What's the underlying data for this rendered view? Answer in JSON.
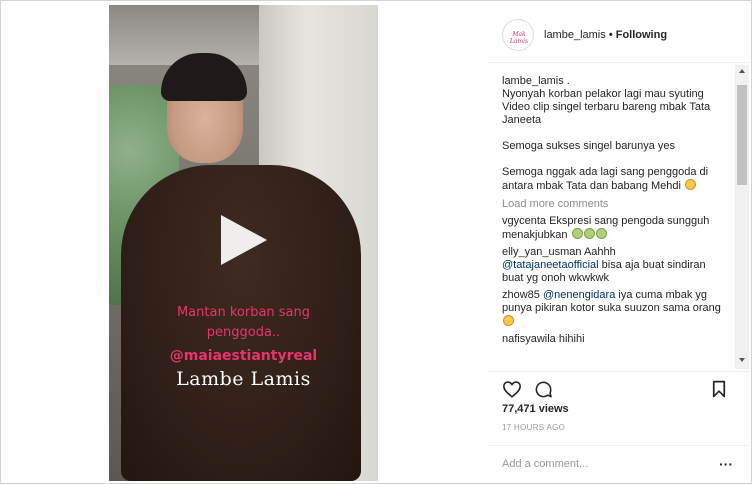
{
  "post": {
    "username": "lambe_lamis",
    "separator": "•",
    "follow_label": "Following",
    "avatar_text": "Mak Lamis"
  },
  "video": {
    "overlay_line1": "Mantan korban sang",
    "overlay_line2": "penggoda..",
    "overlay_mention": "@maiaestiantyreal",
    "overlay_brand": "Lambe Lamis"
  },
  "caption": {
    "username": "lambe_lamis .",
    "lines": [
      "Nyonyah korban pelakor lagi mau syuting",
      "Video clip singel terbaru bareng mbak Tata",
      "Janeeta",
      "",
      "Semoga sukses singel barunya yes",
      "",
      "Semoga nggak ada lagi sang penggoda di",
      "antara mbak Tata dan babang Mehdi"
    ]
  },
  "load_more": "Load more comments",
  "comments": [
    {
      "user": "vgycenta",
      "text": "Ekspresi sang pengoda sungguh menakjubkan"
    },
    {
      "user": "elly_yan_usman",
      "text": "Aahhh",
      "mention": "@tatajaneetaofficial",
      "text2": "bisa aja buat sindiran buat yg onoh wkwkwk"
    },
    {
      "user": "zhow85",
      "mention": "@nenengidara",
      "text": "iya cuma mbak yg punya pikiran kotor suka suuzon sama orang"
    },
    {
      "user": "nafisyawila",
      "text": "hihihi"
    }
  ],
  "stats": {
    "views": "77,471 views",
    "time": "17 HOURS AGO"
  },
  "add_comment": {
    "placeholder": "Add a comment..."
  },
  "icons": {
    "like": "heart-icon",
    "comment": "comment-icon",
    "save": "bookmark-icon",
    "more": "more-icon",
    "play": "play-icon"
  },
  "colors": {
    "overlay_pink": "#e8336f",
    "mention": "#003569",
    "muted": "#8e8e8e"
  }
}
